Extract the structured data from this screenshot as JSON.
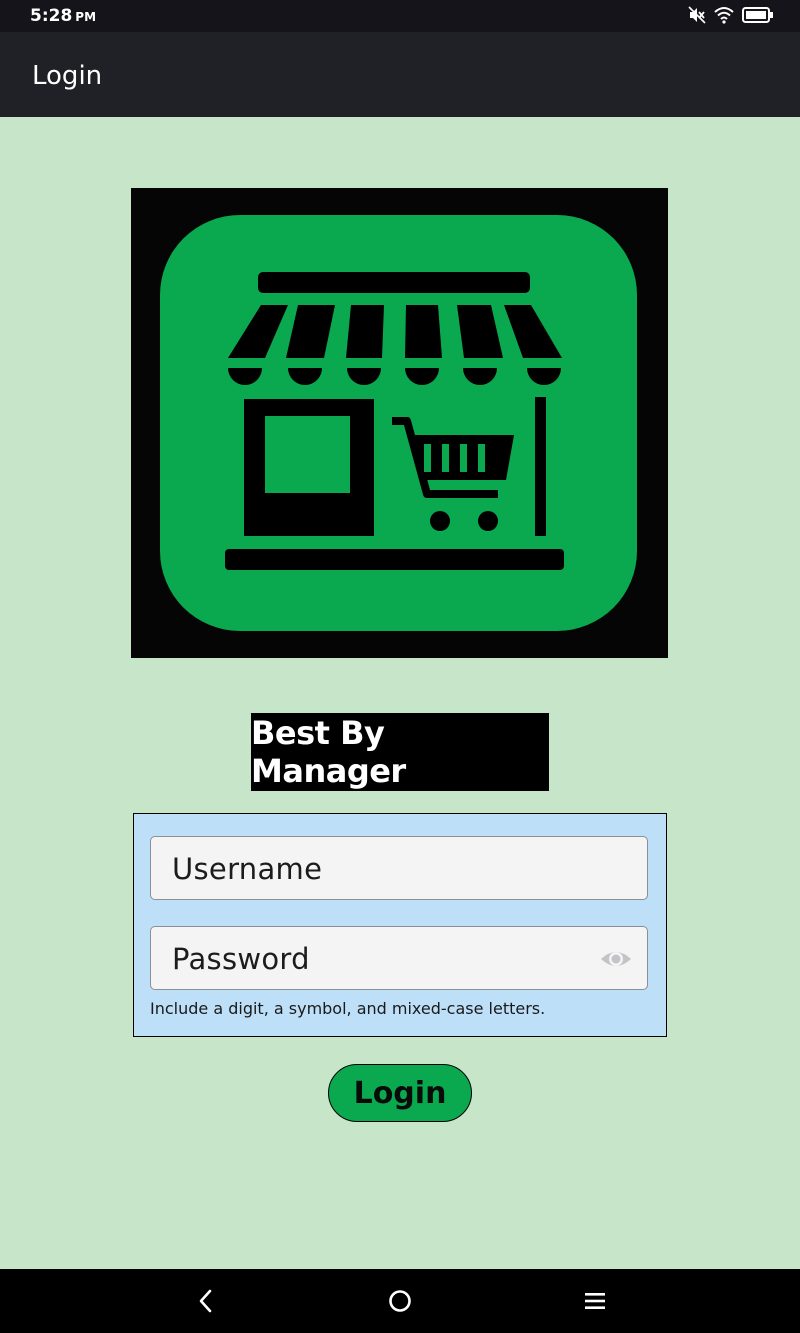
{
  "status_bar": {
    "time": "5:28",
    "ampm": "PM",
    "icons": [
      "mute-icon",
      "wifi-icon",
      "battery-icon"
    ]
  },
  "app_bar": {
    "title": "Login"
  },
  "logo": {
    "icon": "storefront-cart-icon",
    "colors": {
      "background": "#050505",
      "tile": "#0aa94f",
      "glyph": "#000000"
    }
  },
  "brand": {
    "name": "Best By Manager"
  },
  "form": {
    "username": {
      "placeholder": "Username",
      "value": ""
    },
    "password": {
      "placeholder": "Password",
      "value": "",
      "toggle_icon": "eye-icon"
    },
    "hint": "Include a digit, a symbol, and mixed-case letters."
  },
  "login_button": {
    "label": "Login",
    "color": "#0aa94f"
  },
  "nav_bar": {
    "buttons": [
      "back-icon",
      "home-icon",
      "menu-icon"
    ]
  },
  "colors": {
    "page_background": "#c7e6c9",
    "form_background": "#bddff8",
    "app_bar": "#202027"
  }
}
